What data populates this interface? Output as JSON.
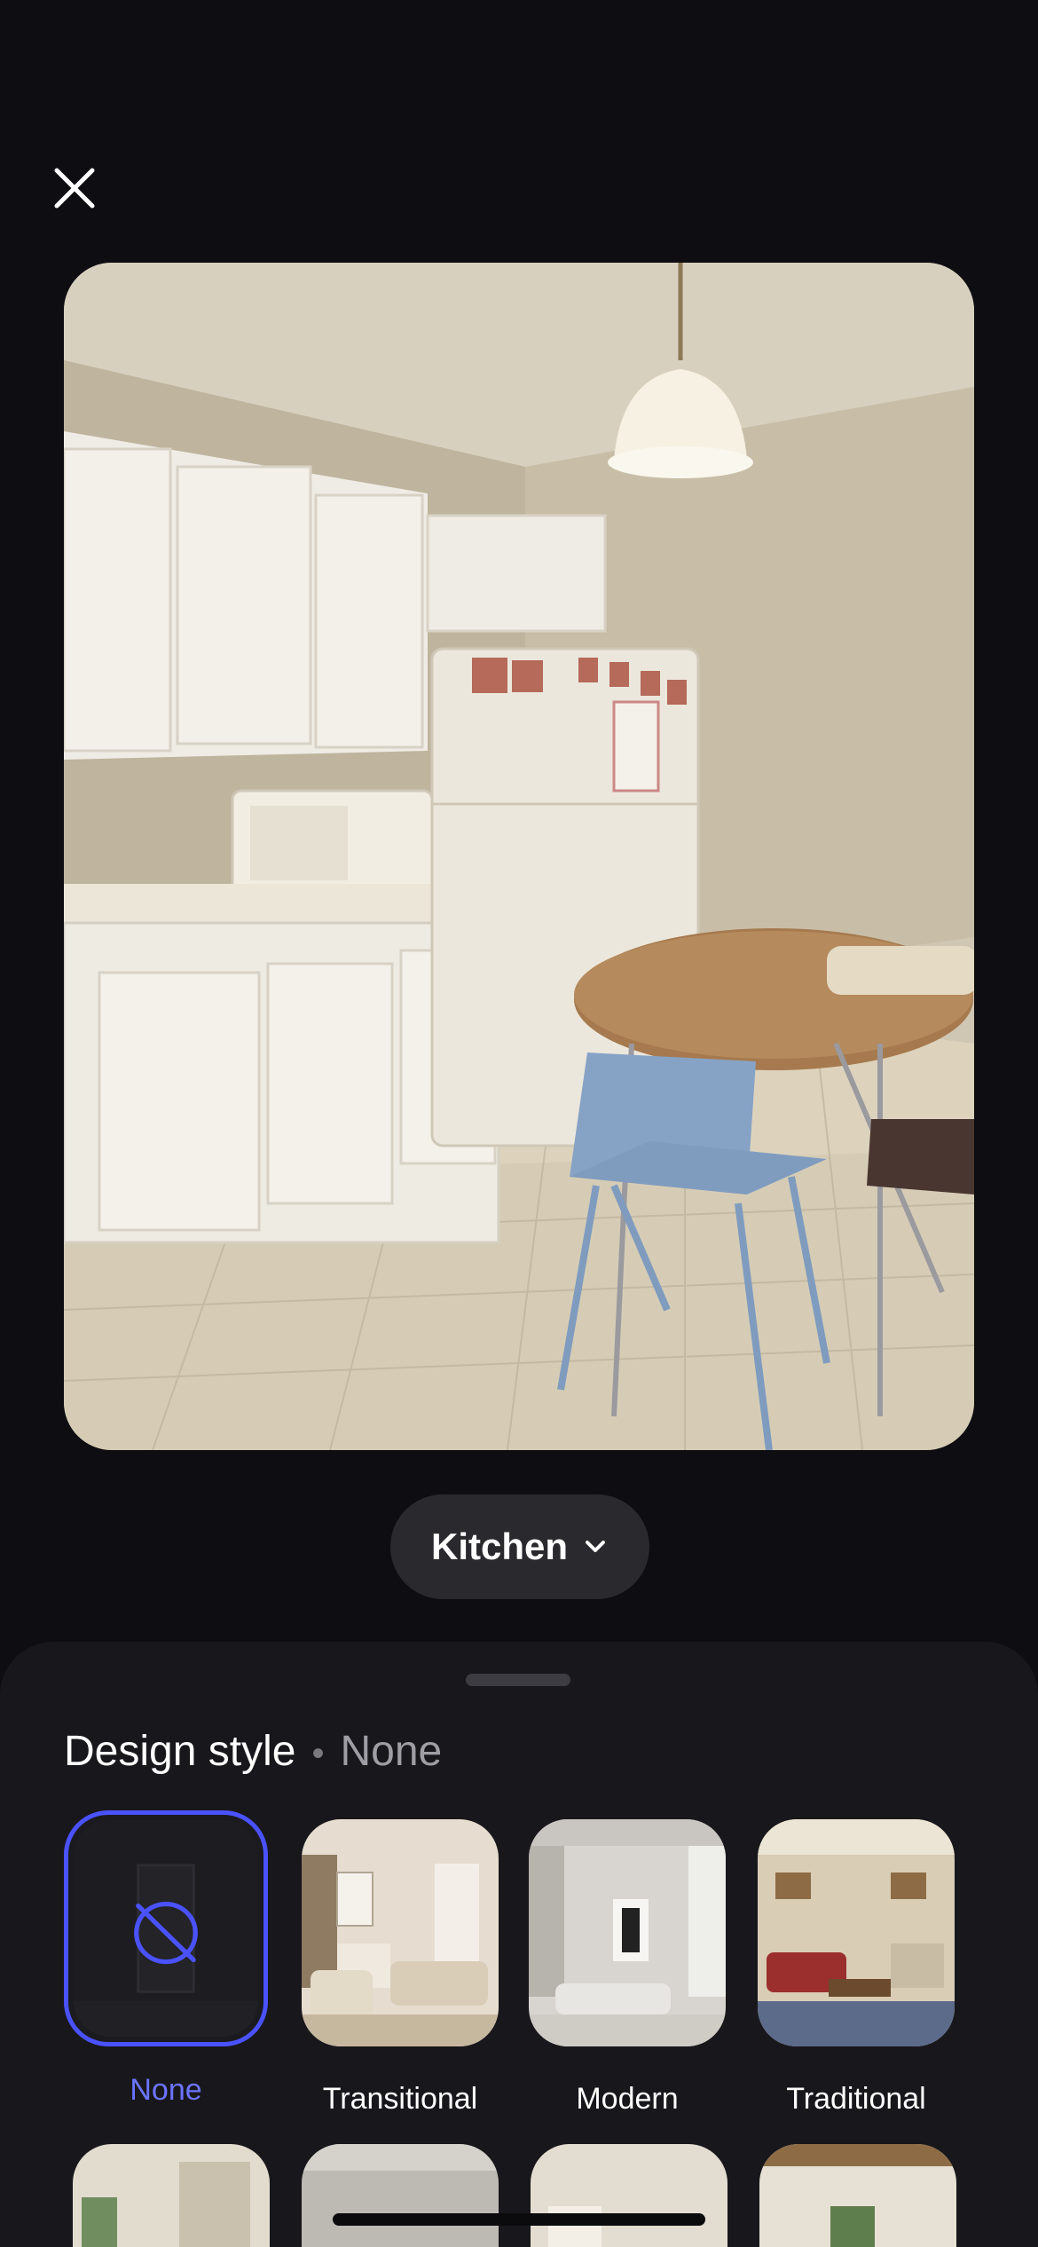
{
  "room_selector": {
    "label": "Kitchen"
  },
  "sheet": {
    "title": "Design style",
    "selected_value": "None",
    "styles": [
      {
        "label": "None",
        "selected": true
      },
      {
        "label": "Transitional",
        "selected": false
      },
      {
        "label": "Modern",
        "selected": false
      },
      {
        "label": "Traditional",
        "selected": false
      }
    ]
  },
  "colors": {
    "accent": "#4a52ff",
    "accent_text": "#6c74ff",
    "background": "#0e0d12",
    "sheet": "#18171c"
  }
}
